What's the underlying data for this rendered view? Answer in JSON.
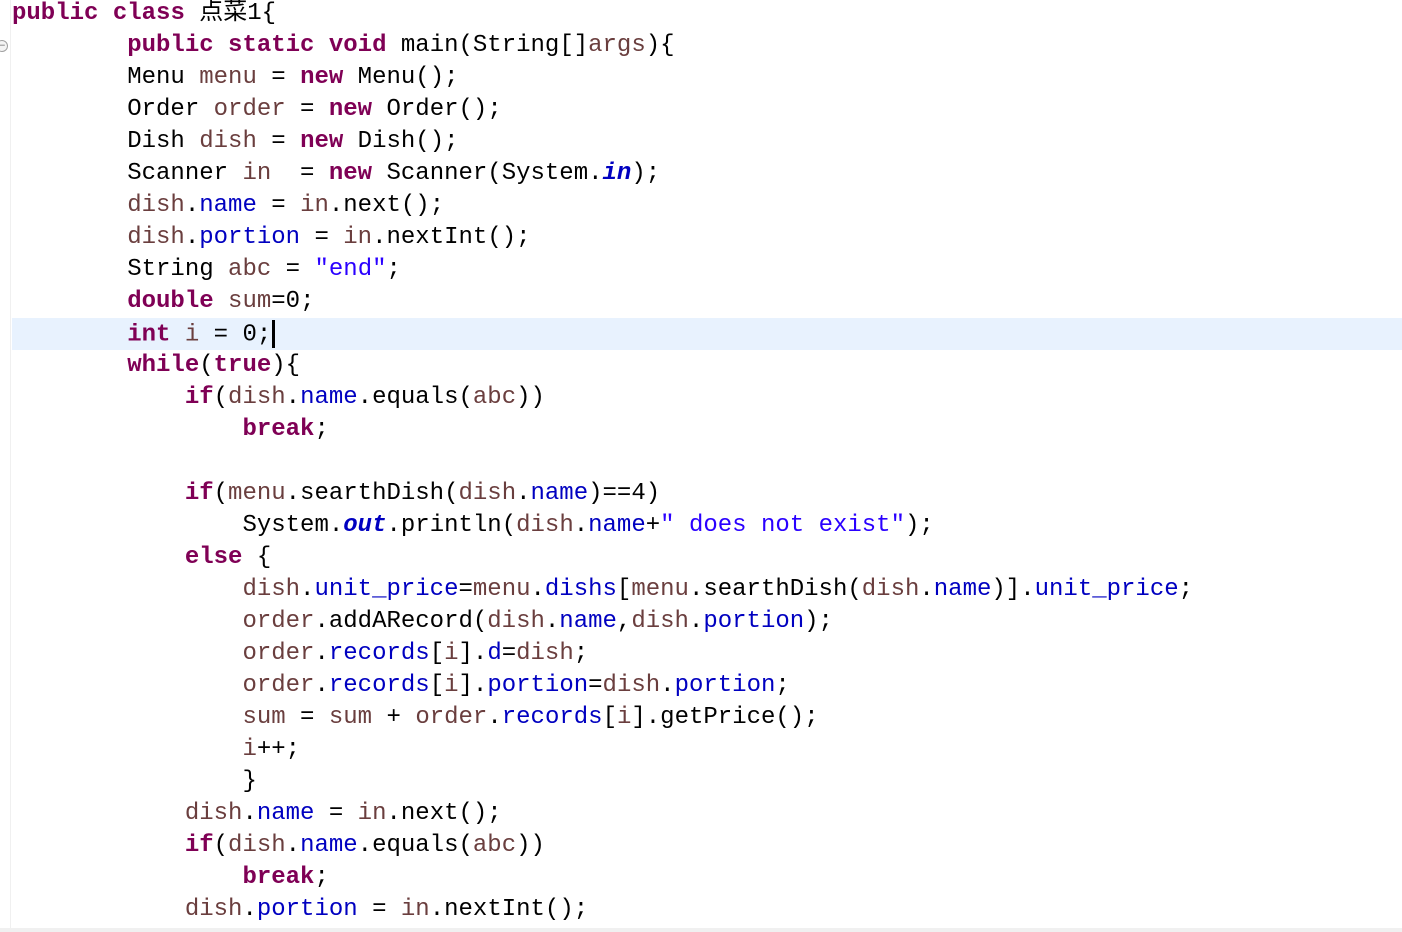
{
  "editor": {
    "gutter": {
      "fold_marker_label": "−"
    },
    "lines": [
      [
        {
          "t": "kw",
          "v": "public"
        },
        {
          "t": "txt",
          "v": " "
        },
        {
          "t": "kw",
          "v": "class"
        },
        {
          "t": "txt",
          "v": " 点菜1{"
        }
      ],
      [
        {
          "t": "txt",
          "v": "        "
        },
        {
          "t": "kw",
          "v": "public"
        },
        {
          "t": "txt",
          "v": " "
        },
        {
          "t": "kw",
          "v": "static"
        },
        {
          "t": "txt",
          "v": " "
        },
        {
          "t": "kw",
          "v": "void"
        },
        {
          "t": "txt",
          "v": " main(String[]"
        },
        {
          "t": "var",
          "v": "args"
        },
        {
          "t": "txt",
          "v": "){"
        }
      ],
      [
        {
          "t": "txt",
          "v": "        Menu "
        },
        {
          "t": "var",
          "v": "menu"
        },
        {
          "t": "txt",
          "v": " = "
        },
        {
          "t": "kw",
          "v": "new"
        },
        {
          "t": "txt",
          "v": " Menu();"
        }
      ],
      [
        {
          "t": "txt",
          "v": "        Order "
        },
        {
          "t": "var",
          "v": "order"
        },
        {
          "t": "txt",
          "v": " = "
        },
        {
          "t": "kw",
          "v": "new"
        },
        {
          "t": "txt",
          "v": " Order();"
        }
      ],
      [
        {
          "t": "txt",
          "v": "        Dish "
        },
        {
          "t": "var",
          "v": "dish"
        },
        {
          "t": "txt",
          "v": " = "
        },
        {
          "t": "kw",
          "v": "new"
        },
        {
          "t": "txt",
          "v": " Dish();"
        }
      ],
      [
        {
          "t": "txt",
          "v": "        Scanner "
        },
        {
          "t": "var",
          "v": "in"
        },
        {
          "t": "txt",
          "v": "  = "
        },
        {
          "t": "kw",
          "v": "new"
        },
        {
          "t": "txt",
          "v": " Scanner(System."
        },
        {
          "t": "sfld",
          "v": "in"
        },
        {
          "t": "txt",
          "v": ");"
        }
      ],
      [
        {
          "t": "txt",
          "v": "        "
        },
        {
          "t": "var",
          "v": "dish"
        },
        {
          "t": "txt",
          "v": "."
        },
        {
          "t": "fld",
          "v": "name"
        },
        {
          "t": "txt",
          "v": " = "
        },
        {
          "t": "var",
          "v": "in"
        },
        {
          "t": "txt",
          "v": ".next();"
        }
      ],
      [
        {
          "t": "txt",
          "v": "        "
        },
        {
          "t": "var",
          "v": "dish"
        },
        {
          "t": "txt",
          "v": "."
        },
        {
          "t": "fld",
          "v": "portion"
        },
        {
          "t": "txt",
          "v": " = "
        },
        {
          "t": "var",
          "v": "in"
        },
        {
          "t": "txt",
          "v": ".nextInt();"
        }
      ],
      [
        {
          "t": "txt",
          "v": "        String "
        },
        {
          "t": "var",
          "v": "abc"
        },
        {
          "t": "txt",
          "v": " = "
        },
        {
          "t": "str",
          "v": "\"end\""
        },
        {
          "t": "txt",
          "v": ";"
        }
      ],
      [
        {
          "t": "txt",
          "v": "        "
        },
        {
          "t": "kw",
          "v": "double"
        },
        {
          "t": "txt",
          "v": " "
        },
        {
          "t": "var",
          "v": "sum"
        },
        {
          "t": "txt",
          "v": "=0;"
        }
      ],
      [
        {
          "t": "txt",
          "v": "        "
        },
        {
          "t": "kw",
          "v": "int"
        },
        {
          "t": "txt",
          "v": " "
        },
        {
          "t": "var",
          "v": "i"
        },
        {
          "t": "txt",
          "v": " = 0;"
        },
        {
          "t": "caret",
          "v": ""
        }
      ],
      [
        {
          "t": "txt",
          "v": "        "
        },
        {
          "t": "kw",
          "v": "while"
        },
        {
          "t": "txt",
          "v": "("
        },
        {
          "t": "kw",
          "v": "true"
        },
        {
          "t": "txt",
          "v": "){"
        }
      ],
      [
        {
          "t": "txt",
          "v": "            "
        },
        {
          "t": "kw",
          "v": "if"
        },
        {
          "t": "txt",
          "v": "("
        },
        {
          "t": "var",
          "v": "dish"
        },
        {
          "t": "txt",
          "v": "."
        },
        {
          "t": "fld",
          "v": "name"
        },
        {
          "t": "txt",
          "v": ".equals("
        },
        {
          "t": "var",
          "v": "abc"
        },
        {
          "t": "txt",
          "v": "))"
        }
      ],
      [
        {
          "t": "txt",
          "v": "                "
        },
        {
          "t": "kw",
          "v": "break"
        },
        {
          "t": "txt",
          "v": ";"
        }
      ],
      [
        {
          "t": "txt",
          "v": ""
        }
      ],
      [
        {
          "t": "txt",
          "v": "            "
        },
        {
          "t": "kw",
          "v": "if"
        },
        {
          "t": "txt",
          "v": "("
        },
        {
          "t": "var",
          "v": "menu"
        },
        {
          "t": "txt",
          "v": ".searthDish("
        },
        {
          "t": "var",
          "v": "dish"
        },
        {
          "t": "txt",
          "v": "."
        },
        {
          "t": "fld",
          "v": "name"
        },
        {
          "t": "txt",
          "v": ")==4)"
        }
      ],
      [
        {
          "t": "txt",
          "v": "                System."
        },
        {
          "t": "sfld",
          "v": "out"
        },
        {
          "t": "txt",
          "v": ".println("
        },
        {
          "t": "var",
          "v": "dish"
        },
        {
          "t": "txt",
          "v": "."
        },
        {
          "t": "fld",
          "v": "name"
        },
        {
          "t": "txt",
          "v": "+"
        },
        {
          "t": "str",
          "v": "\" does not exist\""
        },
        {
          "t": "txt",
          "v": ");"
        }
      ],
      [
        {
          "t": "txt",
          "v": "            "
        },
        {
          "t": "kw",
          "v": "else"
        },
        {
          "t": "txt",
          "v": " {"
        }
      ],
      [
        {
          "t": "txt",
          "v": "                "
        },
        {
          "t": "var",
          "v": "dish"
        },
        {
          "t": "txt",
          "v": "."
        },
        {
          "t": "fld",
          "v": "unit_price"
        },
        {
          "t": "txt",
          "v": "="
        },
        {
          "t": "var",
          "v": "menu"
        },
        {
          "t": "txt",
          "v": "."
        },
        {
          "t": "fld",
          "v": "dishs"
        },
        {
          "t": "txt",
          "v": "["
        },
        {
          "t": "var",
          "v": "menu"
        },
        {
          "t": "txt",
          "v": ".searthDish("
        },
        {
          "t": "var",
          "v": "dish"
        },
        {
          "t": "txt",
          "v": "."
        },
        {
          "t": "fld",
          "v": "name"
        },
        {
          "t": "txt",
          "v": ")]."
        },
        {
          "t": "fld",
          "v": "unit_price"
        },
        {
          "t": "txt",
          "v": ";"
        }
      ],
      [
        {
          "t": "txt",
          "v": "                "
        },
        {
          "t": "var",
          "v": "order"
        },
        {
          "t": "txt",
          "v": ".addARecord("
        },
        {
          "t": "var",
          "v": "dish"
        },
        {
          "t": "txt",
          "v": "."
        },
        {
          "t": "fld",
          "v": "name"
        },
        {
          "t": "txt",
          "v": ","
        },
        {
          "t": "var",
          "v": "dish"
        },
        {
          "t": "txt",
          "v": "."
        },
        {
          "t": "fld",
          "v": "portion"
        },
        {
          "t": "txt",
          "v": ");"
        }
      ],
      [
        {
          "t": "txt",
          "v": "                "
        },
        {
          "t": "var",
          "v": "order"
        },
        {
          "t": "txt",
          "v": "."
        },
        {
          "t": "fld",
          "v": "records"
        },
        {
          "t": "txt",
          "v": "["
        },
        {
          "t": "var",
          "v": "i"
        },
        {
          "t": "txt",
          "v": "]."
        },
        {
          "t": "fld",
          "v": "d"
        },
        {
          "t": "txt",
          "v": "="
        },
        {
          "t": "var",
          "v": "dish"
        },
        {
          "t": "txt",
          "v": ";"
        }
      ],
      [
        {
          "t": "txt",
          "v": "                "
        },
        {
          "t": "var",
          "v": "order"
        },
        {
          "t": "txt",
          "v": "."
        },
        {
          "t": "fld",
          "v": "records"
        },
        {
          "t": "txt",
          "v": "["
        },
        {
          "t": "var",
          "v": "i"
        },
        {
          "t": "txt",
          "v": "]."
        },
        {
          "t": "fld",
          "v": "portion"
        },
        {
          "t": "txt",
          "v": "="
        },
        {
          "t": "var",
          "v": "dish"
        },
        {
          "t": "txt",
          "v": "."
        },
        {
          "t": "fld",
          "v": "portion"
        },
        {
          "t": "txt",
          "v": ";"
        }
      ],
      [
        {
          "t": "txt",
          "v": "                "
        },
        {
          "t": "var",
          "v": "sum"
        },
        {
          "t": "txt",
          "v": " = "
        },
        {
          "t": "var",
          "v": "sum"
        },
        {
          "t": "txt",
          "v": " + "
        },
        {
          "t": "var",
          "v": "order"
        },
        {
          "t": "txt",
          "v": "."
        },
        {
          "t": "fld",
          "v": "records"
        },
        {
          "t": "txt",
          "v": "["
        },
        {
          "t": "var",
          "v": "i"
        },
        {
          "t": "txt",
          "v": "].getPrice();"
        }
      ],
      [
        {
          "t": "txt",
          "v": "                "
        },
        {
          "t": "var",
          "v": "i"
        },
        {
          "t": "txt",
          "v": "++;"
        }
      ],
      [
        {
          "t": "txt",
          "v": "                }"
        }
      ],
      [
        {
          "t": "txt",
          "v": "            "
        },
        {
          "t": "var",
          "v": "dish"
        },
        {
          "t": "txt",
          "v": "."
        },
        {
          "t": "fld",
          "v": "name"
        },
        {
          "t": "txt",
          "v": " = "
        },
        {
          "t": "var",
          "v": "in"
        },
        {
          "t": "txt",
          "v": ".next();"
        }
      ],
      [
        {
          "t": "txt",
          "v": "            "
        },
        {
          "t": "kw",
          "v": "if"
        },
        {
          "t": "txt",
          "v": "("
        },
        {
          "t": "var",
          "v": "dish"
        },
        {
          "t": "txt",
          "v": "."
        },
        {
          "t": "fld",
          "v": "name"
        },
        {
          "t": "txt",
          "v": ".equals("
        },
        {
          "t": "var",
          "v": "abc"
        },
        {
          "t": "txt",
          "v": "))"
        }
      ],
      [
        {
          "t": "txt",
          "v": "                "
        },
        {
          "t": "kw",
          "v": "break"
        },
        {
          "t": "txt",
          "v": ";"
        }
      ],
      [
        {
          "t": "txt",
          "v": "            "
        },
        {
          "t": "var",
          "v": "dish"
        },
        {
          "t": "txt",
          "v": "."
        },
        {
          "t": "fld",
          "v": "portion"
        },
        {
          "t": "txt",
          "v": " = "
        },
        {
          "t": "var",
          "v": "in"
        },
        {
          "t": "txt",
          "v": ".nextInt();"
        }
      ]
    ],
    "current_line_index": 10,
    "colors": {
      "keyword": "#7f0055",
      "local_variable": "#6a3e3e",
      "field": "#0000c0",
      "string": "#2a00ff",
      "current_line_highlight": "#e8f2fe"
    }
  }
}
